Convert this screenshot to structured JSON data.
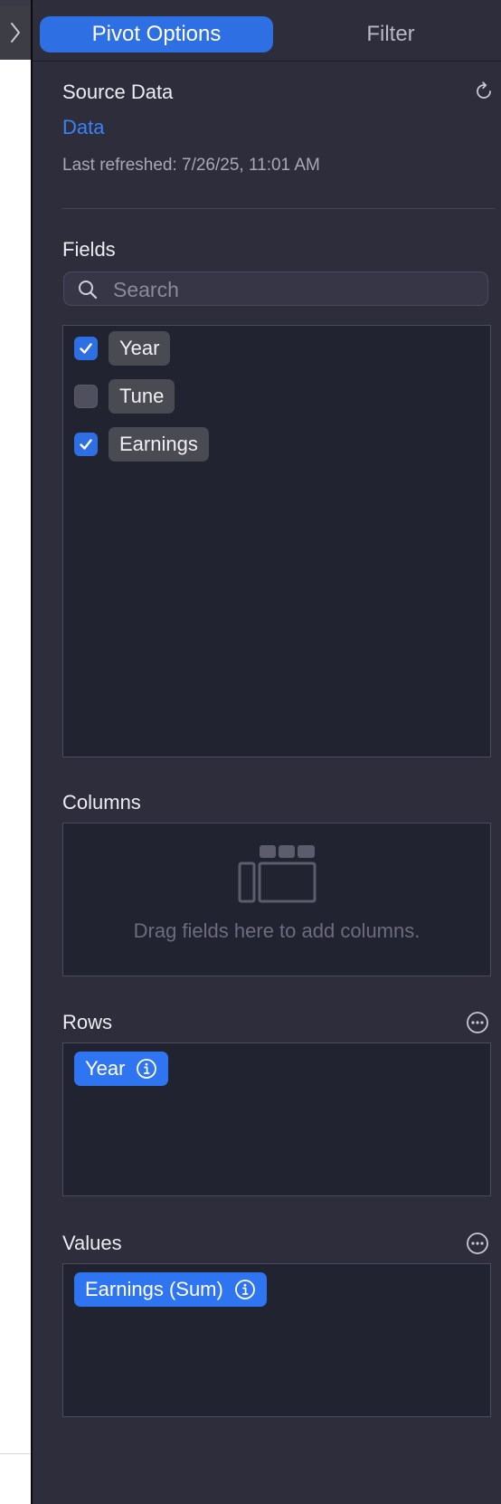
{
  "tabs": {
    "pivot_options": "Pivot Options",
    "filter": "Filter"
  },
  "source": {
    "heading": "Source Data",
    "link": "Data",
    "refreshed": "Last refreshed: 7/26/25, 11:01 AM"
  },
  "fields": {
    "heading": "Fields",
    "search_placeholder": "Search",
    "search_value": "",
    "items": [
      {
        "label": "Year",
        "checked": true
      },
      {
        "label": "Tune",
        "checked": false
      },
      {
        "label": "Earnings",
        "checked": true
      }
    ]
  },
  "columns": {
    "heading": "Columns",
    "hint": "Drag fields here to add columns."
  },
  "rows": {
    "heading": "Rows",
    "items": [
      "Year"
    ]
  },
  "values": {
    "heading": "Values",
    "items": [
      "Earnings (Sum)"
    ]
  },
  "colors": {
    "accent": "#2f6fe4",
    "link": "#3b82f6",
    "panel": "#2d2d3b",
    "well": "#222331"
  },
  "icons": [
    "chevron-right-icon",
    "refresh-icon",
    "search-icon",
    "checkmark-icon",
    "columns-layout-icon",
    "more-icon",
    "info-icon"
  ]
}
